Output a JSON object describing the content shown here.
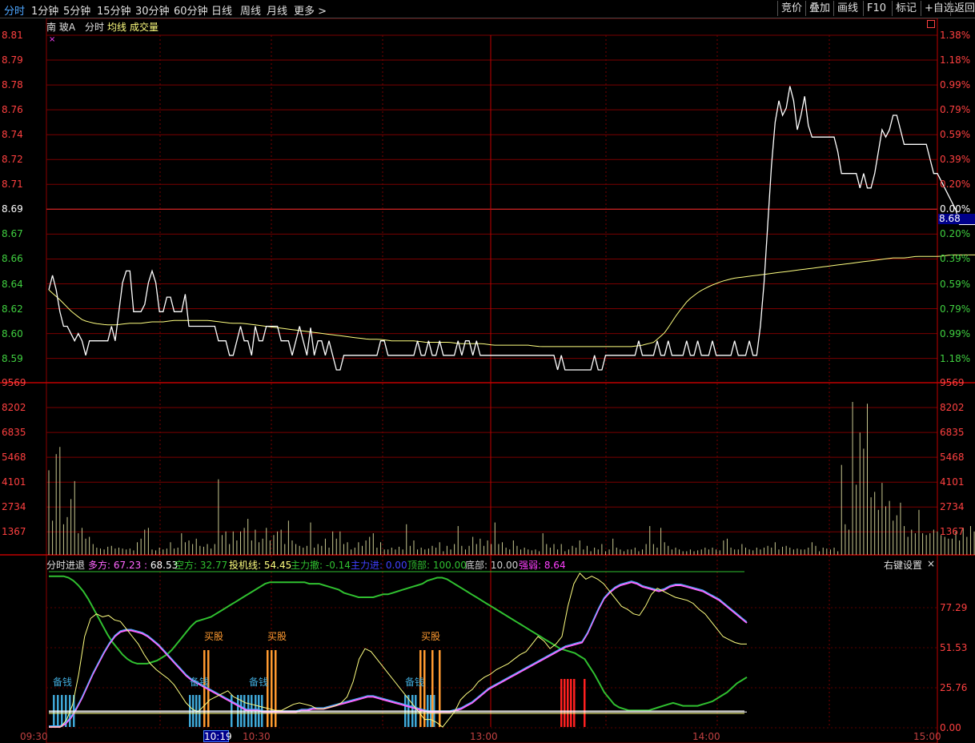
{
  "topbar": {
    "tabs": [
      "分时",
      "1分钟",
      "5分钟",
      "15分钟",
      "30分钟",
      "60分钟",
      "日线",
      "周线",
      "月线",
      "更多 >"
    ],
    "right_buttons": [
      "竞价",
      "叠加",
      "画线",
      "F10",
      "标记",
      "+自选",
      "返回"
    ]
  },
  "header": {
    "stock": "南 玻A",
    "mode": "分时",
    "legend_avg": "均线",
    "legend_vol": "成交量",
    "current_price": "8.68"
  },
  "colors": {
    "up": "#ff4040",
    "down": "#40d040",
    "price": "#ffffff",
    "avg": "#ffff80",
    "grid": "#8b0000",
    "volume": "#c8c890",
    "flat": "#ffffff"
  },
  "chart_data": [
    {
      "type": "line",
      "title": "",
      "y_ticks_left": [
        "8.81",
        "8.79",
        "8.78",
        "8.76",
        "8.74",
        "8.72",
        "8.71",
        "8.69",
        "8.67",
        "8.66",
        "8.64",
        "8.62",
        "8.60",
        "8.59"
      ],
      "y_ticks_right": [
        "1.38%",
        "1.18%",
        "0.99%",
        "0.79%",
        "0.59%",
        "0.39%",
        "0.20%",
        "0.00%",
        "0.20%",
        "0.39%",
        "0.59%",
        "0.79%",
        "0.99%",
        "1.18%"
      ],
      "ylim": [
        8.58,
        8.81
      ],
      "prev_close": 8.69,
      "x_ticks": [
        "09:30",
        "10:30",
        "13:00",
        "14:00",
        "15:00"
      ],
      "series": [
        {
          "values": [
            8.635,
            8.645,
            8.635,
            8.62,
            8.61,
            8.61,
            8.605,
            8.6,
            8.605,
            8.6,
            8.59,
            8.6,
            8.6,
            8.6,
            8.6,
            8.6,
            8.6,
            8.61,
            8.6,
            8.62,
            8.64,
            8.648,
            8.648,
            8.62,
            8.62,
            8.62,
            8.625,
            8.64,
            8.648,
            8.64,
            8.62,
            8.62,
            8.63,
            8.63,
            8.62,
            8.62,
            8.62,
            8.632,
            8.61,
            8.61,
            8.61,
            8.61,
            8.61,
            8.61,
            8.61,
            8.61,
            8.6,
            8.6,
            8.6,
            8.59,
            8.59,
            8.6,
            8.61,
            8.6,
            8.6,
            8.59,
            8.61,
            8.6,
            8.6,
            8.61,
            8.61,
            8.61,
            8.61,
            8.6,
            8.6,
            8.6,
            8.59,
            8.6,
            8.61,
            8.6,
            8.59,
            8.609,
            8.59,
            8.6,
            8.6,
            8.59,
            8.6,
            8.59,
            8.58,
            8.58,
            8.59,
            8.59,
            8.59,
            8.59,
            8.59,
            8.59,
            8.59,
            8.59,
            8.59,
            8.59,
            8.6,
            8.6,
            8.59,
            8.59,
            8.59,
            8.59,
            8.59,
            8.59,
            8.59,
            8.59,
            8.6,
            8.59,
            8.59,
            8.6,
            8.59,
            8.59,
            8.6,
            8.59,
            8.59,
            8.59,
            8.59,
            8.6,
            8.59,
            8.6,
            8.6,
            8.59,
            8.6,
            8.59,
            8.59,
            8.59,
            8.59,
            8.59,
            8.59,
            8.59,
            8.59,
            8.59,
            8.59,
            8.59,
            8.59,
            8.59,
            8.59,
            8.59,
            8.59,
            8.59,
            8.59,
            8.59,
            8.59,
            8.59,
            8.58,
            8.59,
            8.58,
            8.58,
            8.58,
            8.58,
            8.58,
            8.58,
            8.58,
            8.58,
            8.59,
            8.58,
            8.58,
            8.59,
            8.59,
            8.59,
            8.59,
            8.59,
            8.59,
            8.59,
            8.59,
            8.59,
            8.6,
            8.59,
            8.59,
            8.59,
            8.59,
            8.6,
            8.59,
            8.59,
            8.6,
            8.59,
            8.59,
            8.59,
            8.59,
            8.6,
            8.59,
            8.59,
            8.6,
            8.59,
            8.59,
            8.59,
            8.6,
            8.59,
            8.59,
            8.59,
            8.59,
            8.59,
            8.6,
            8.59,
            8.59,
            8.59,
            8.6,
            8.59,
            8.59,
            8.61,
            8.64,
            8.68,
            8.72,
            8.75,
            8.765,
            8.755,
            8.76,
            8.775,
            8.765,
            8.745,
            8.755,
            8.768,
            8.748,
            8.74,
            8.74,
            8.74,
            8.74,
            8.74,
            8.74,
            8.74,
            8.73,
            8.715,
            8.715,
            8.715,
            8.715,
            8.715,
            8.705,
            8.715,
            8.705,
            8.705,
            8.715,
            8.73,
            8.745,
            8.74,
            8.745,
            8.755,
            8.755,
            8.745,
            8.735,
            8.735,
            8.735,
            8.735,
            8.735,
            8.735,
            8.735,
            8.725,
            8.715,
            8.715,
            8.71,
            8.705,
            8.7,
            8.695,
            8.69,
            8.68,
            8.68,
            8.68,
            8.68,
            8.68,
            8.68,
            8.68,
            8.688,
            8.68,
            8.68,
            8.68
          ],
          "note_only_price": true
        },
        {
          "values": [
            8.635,
            8.628,
            8.62,
            8.614,
            8.612,
            8.611,
            8.611,
            8.612,
            8.612,
            8.613,
            8.613,
            8.614,
            8.614,
            8.614,
            8.614,
            8.613,
            8.612,
            8.612,
            8.611,
            8.61,
            8.609,
            8.608,
            8.607,
            8.606,
            8.605,
            8.604,
            8.603,
            8.602,
            8.601,
            8.601,
            8.6,
            8.6,
            8.6,
            8.599,
            8.599,
            8.599,
            8.598,
            8.598,
            8.598,
            8.597,
            8.597,
            8.597,
            8.597,
            8.596,
            8.596,
            8.596,
            8.596,
            8.596,
            8.596,
            8.596,
            8.596,
            8.596,
            8.597,
            8.599,
            8.606,
            8.618,
            8.628,
            8.634,
            8.638,
            8.641,
            8.643,
            8.644,
            8.645,
            8.646,
            8.647,
            8.648,
            8.649,
            8.65,
            8.651,
            8.652,
            8.653,
            8.654,
            8.655,
            8.656,
            8.657,
            8.657,
            8.658,
            8.658,
            8.658,
            8.659,
            8.659,
            8.659,
            8.659,
            8.659
          ]
        }
      ]
    },
    {
      "type": "bar",
      "title": "",
      "y_ticks_left": [
        "9569",
        "8202",
        "6835",
        "5468",
        "4101",
        "2734",
        "1367"
      ],
      "ylim": [
        0,
        9569
      ],
      "values": [
        4700,
        1900,
        5600,
        6000,
        1700,
        2100,
        3100,
        4100,
        1200,
        1500,
        900,
        1000,
        600,
        400,
        350,
        300,
        450,
        500,
        350,
        400,
        350,
        300,
        350,
        250,
        700,
        900,
        1400,
        1500,
        300,
        250,
        400,
        300,
        350,
        700,
        350,
        400,
        1200,
        700,
        800,
        600,
        900,
        500,
        450,
        600,
        350,
        600,
        4200,
        1100,
        1300,
        600,
        1300,
        800,
        1300,
        1500,
        2000,
        800,
        1400,
        700,
        900,
        1500,
        800,
        1100,
        1300,
        1400,
        600,
        1900,
        800,
        600,
        500,
        400,
        500,
        1800,
        400,
        600,
        500,
        900,
        400,
        1300,
        900,
        1300,
        600,
        700,
        300,
        400,
        700,
        500,
        800,
        1000,
        1200,
        400,
        700,
        300,
        300,
        400,
        300,
        450,
        300,
        1700,
        500,
        800,
        300,
        400,
        300,
        350,
        500,
        400,
        700,
        200,
        500,
        300,
        600,
        1600,
        500,
        300,
        500,
        1000,
        600,
        900,
        500,
        800,
        600,
        1800,
        600,
        700,
        400,
        300,
        800,
        500,
        300,
        400,
        300,
        250,
        300,
        200,
        1200,
        600,
        400,
        600,
        300,
        600,
        200,
        300,
        500,
        400,
        800,
        300,
        500,
        200,
        400,
        300,
        600,
        200,
        300,
        900,
        400,
        300,
        200,
        300,
        300,
        400,
        200,
        300,
        600,
        1600,
        600,
        400,
        1500,
        700,
        500,
        300,
        400,
        300,
        200,
        200,
        300,
        200,
        250,
        300,
        400,
        300,
        400,
        300,
        250,
        800,
        900,
        400,
        300,
        300,
        600,
        400,
        300,
        250,
        400,
        300,
        400,
        500,
        400,
        700,
        300,
        450,
        500,
        400,
        300,
        350,
        300,
        300,
        400,
        700,
        500,
        200,
        400,
        350,
        300,
        400,
        200,
        5000,
        1700,
        1400,
        8500,
        3900,
        6800,
        5900,
        8400,
        3200,
        3500,
        2500,
        4000,
        2700,
        3000,
        1900,
        2200,
        2900,
        1600,
        1000,
        1400,
        1200,
        2500,
        1200,
        1100,
        1200,
        1400,
        1300,
        1100,
        1000,
        900,
        900,
        1300,
        800,
        1500,
        1000,
        1600,
        1300,
        2000,
        3100,
        1600,
        900,
        600,
        700,
        300,
        800,
        500,
        700,
        1200,
        900,
        700,
        500,
        900,
        800,
        1000,
        800,
        700,
        600,
        500,
        400,
        600,
        300,
        500
      ]
    },
    {
      "type": "line",
      "title": "分时进退",
      "y_ticks_right": [
        "77.29",
        "51.53",
        "25.76",
        "0.00"
      ],
      "ylim": [
        0,
        103
      ],
      "indicators": {
        "name": "分时进退",
        "多方": "67.23",
        "多方2": "68.53",
        "空方": "32.77",
        "投机线": "54.45",
        "主力撤": "-0.14",
        "主力进": "0.00",
        "顶部": "100.00",
        "底部": "10.00",
        "强弱": "8.64"
      },
      "settings_label": "右键设置",
      "signal_labels": [
        "备钱",
        "买股"
      ],
      "series": [
        {
          "name": "空方",
          "color": "#30c030",
          "values": [
            100,
            100,
            100,
            100,
            99,
            97,
            94,
            90,
            85,
            79,
            73,
            67,
            61,
            56,
            52,
            48,
            45,
            43,
            42,
            42,
            42,
            43,
            44,
            46,
            48,
            51,
            55,
            59,
            63,
            67,
            70,
            71,
            72,
            73,
            75,
            77,
            79,
            81,
            83,
            85,
            87,
            89,
            91,
            93,
            95,
            96,
            96,
            96,
            96,
            96,
            96,
            96,
            96,
            95,
            95,
            95,
            94,
            93,
            92,
            91,
            89,
            88,
            87,
            86,
            86,
            86,
            86,
            87,
            88,
            88,
            89,
            90,
            91,
            92,
            93,
            94,
            95,
            97,
            98,
            99,
            99,
            98,
            96,
            94,
            92,
            90,
            88,
            86,
            84,
            82,
            80,
            78,
            76,
            74,
            72,
            70,
            68,
            66,
            64,
            62,
            60,
            58,
            56,
            54,
            52,
            51,
            50,
            49,
            47,
            45,
            40,
            35,
            29,
            23,
            19,
            15,
            13,
            12,
            11,
            11,
            11,
            11,
            11,
            12,
            13,
            14,
            15,
            16,
            15,
            14,
            14,
            14,
            14,
            15,
            16,
            17,
            19,
            21,
            23,
            26,
            29,
            31,
            33
          ]
        },
        {
          "name": "多方",
          "color": "#ff66ff",
          "values": [
            0,
            0,
            0,
            2,
            6,
            12,
            19,
            27,
            35,
            42,
            49,
            55,
            60,
            63,
            64,
            64,
            63,
            62,
            60,
            57,
            54,
            50,
            46,
            42,
            38,
            34,
            31,
            29,
            27,
            25,
            23,
            21,
            19,
            17,
            15,
            13,
            11,
            11,
            11,
            10,
            10,
            10,
            10,
            10,
            10,
            10,
            11,
            11,
            12,
            12,
            12,
            13,
            14,
            15,
            16,
            17,
            18,
            19,
            20,
            20,
            19,
            18,
            17,
            16,
            15,
            14,
            13,
            12,
            11,
            10,
            10,
            10,
            10,
            10,
            11,
            12,
            14,
            16,
            19,
            22,
            25,
            27,
            29,
            31,
            33,
            35,
            37,
            39,
            41,
            43,
            45,
            47,
            49,
            51,
            53,
            54,
            55,
            56,
            62,
            70,
            78,
            85,
            89,
            92,
            94,
            95,
            96,
            95,
            93,
            92,
            91,
            90,
            91,
            93,
            94,
            94,
            93,
            92,
            91,
            90,
            88,
            86,
            84,
            81,
            78,
            75,
            72,
            69
          ]
        },
        {
          "name": "投机线",
          "color": "#ffff80",
          "values": [
            0,
            0,
            0,
            5,
            15,
            35,
            60,
            72,
            75,
            73,
            74,
            71,
            70,
            65,
            60,
            55,
            48,
            42,
            38,
            35,
            32,
            28,
            22,
            16,
            12,
            10,
            14,
            18,
            20,
            22,
            24,
            20,
            18,
            16,
            15,
            14,
            13,
            12,
            11,
            11,
            13,
            15,
            16,
            15,
            14,
            12,
            12,
            13,
            14,
            16,
            20,
            30,
            45,
            52,
            50,
            45,
            40,
            35,
            30,
            25,
            20,
            15,
            10,
            5,
            5,
            3,
            0,
            5,
            10,
            18,
            22,
            25,
            30,
            33,
            35,
            38,
            40,
            42,
            45,
            48,
            50,
            55,
            60,
            57,
            52,
            55,
            60,
            80,
            95,
            102,
            98,
            100,
            98,
            95,
            90,
            85,
            80,
            78,
            75,
            74,
            80,
            88,
            92,
            90,
            88,
            86,
            85,
            84,
            82,
            78,
            75,
            70,
            65,
            60,
            58,
            56,
            55,
            55
          ]
        },
        {
          "name": "主力线",
          "color": "#ffffff",
          "values": [
            10,
            10,
            10,
            10,
            10,
            10,
            10,
            10,
            10,
            10,
            10,
            10,
            10,
            10,
            10,
            10,
            10,
            10,
            10,
            10,
            10,
            10,
            10,
            10,
            10,
            10,
            10,
            10,
            10,
            10
          ]
        }
      ]
    }
  ]
}
